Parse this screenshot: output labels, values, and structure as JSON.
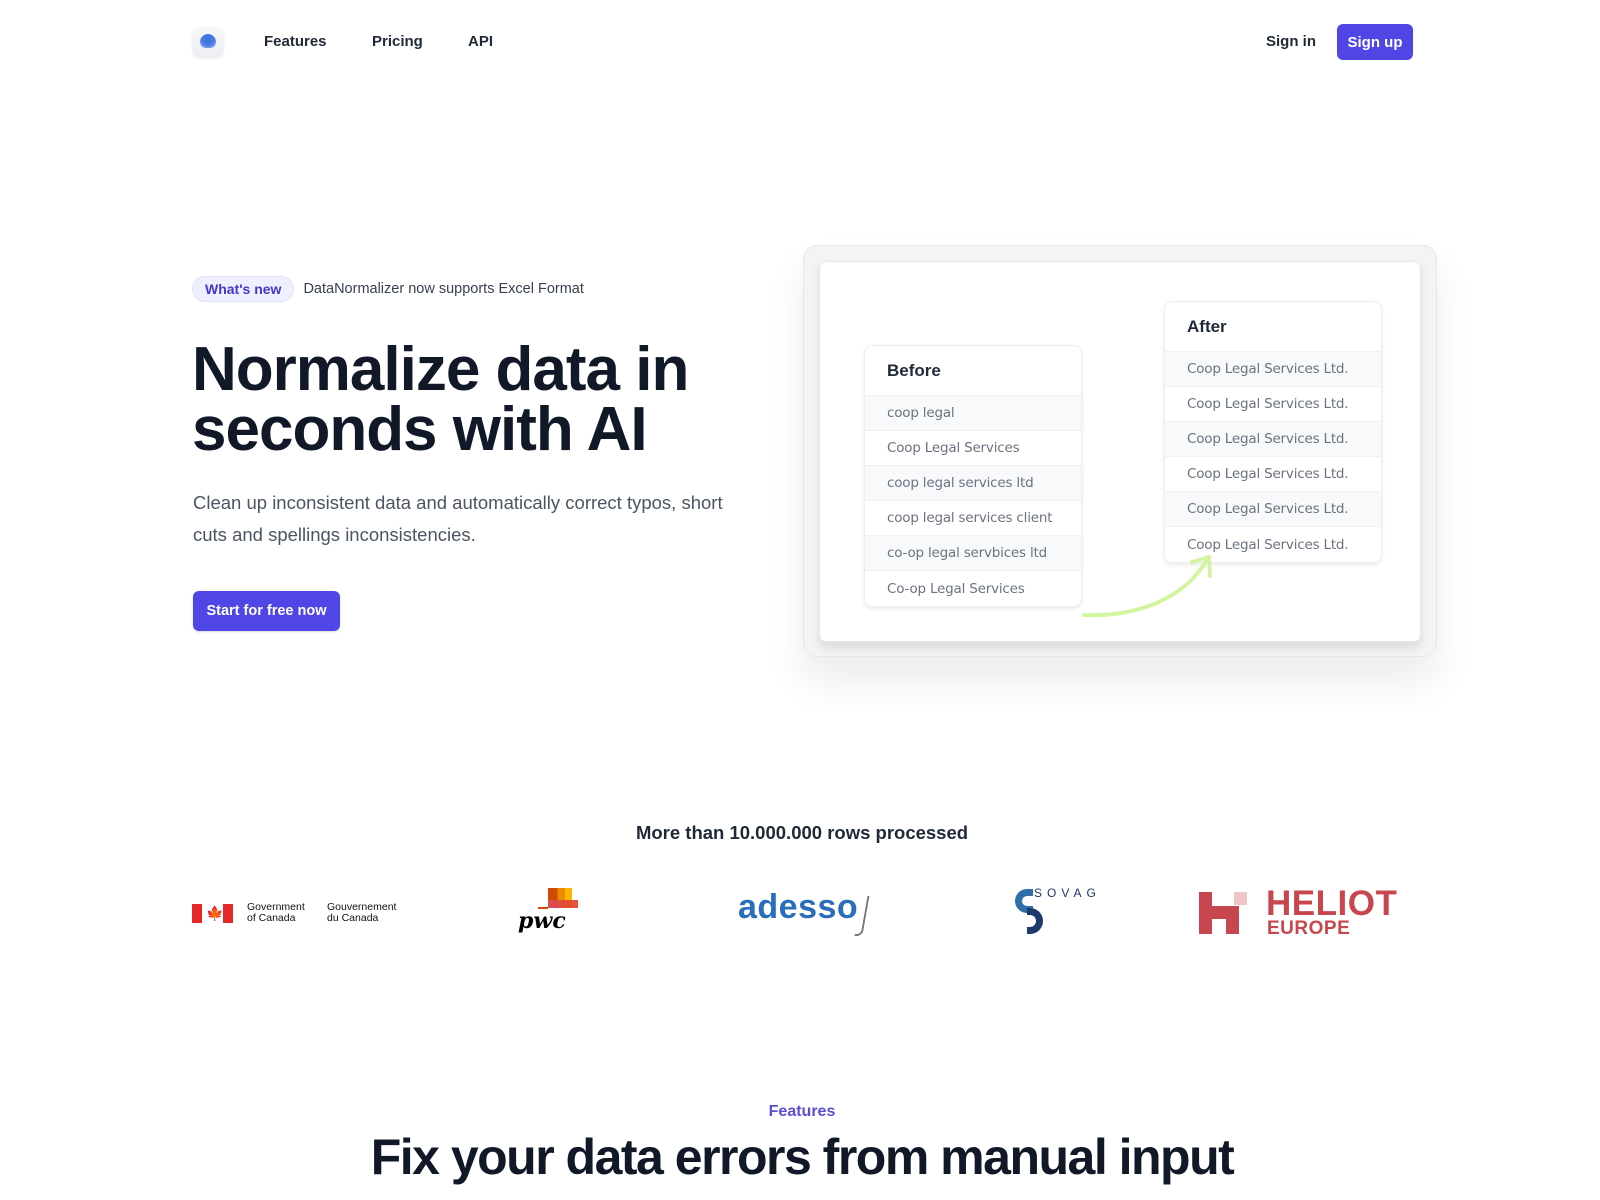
{
  "nav": {
    "logo_icon": "blue-dot-logo",
    "links": [
      "Features",
      "Pricing",
      "API"
    ],
    "sign_in": "Sign in",
    "sign_up": "Sign up"
  },
  "hero": {
    "badge": "What's new",
    "announcement": "DataNormalizer now supports Excel Format",
    "headline_line1": "Normalize data in",
    "headline_line2": "seconds with AI",
    "subtext": "Clean up inconsistent data and automatically correct typos, short cuts and spellings inconsistencies.",
    "cta": "Start for free now"
  },
  "illustration": {
    "before": {
      "title": "Before",
      "rows": [
        "coop legal",
        "Coop Legal Services",
        "coop legal services ltd",
        "coop legal services client",
        "co-op legal servbices ltd",
        "Co-op Legal Services"
      ]
    },
    "after": {
      "title": "After",
      "rows": [
        "Coop Legal Services Ltd.",
        "Coop Legal Services Ltd.",
        "Coop Legal Services Ltd.",
        "Coop Legal Services Ltd.",
        "Coop Legal Services Ltd.",
        "Coop Legal Services Ltd."
      ]
    },
    "arrow_color": "#d4f5a0"
  },
  "social_proof": {
    "stats": "More than 10.000.000 rows processed",
    "logos": {
      "canada_en_1": "Government",
      "canada_en_2": "of Canada",
      "canada_fr_1": "Gouvernement",
      "canada_fr_2": "du Canada",
      "pwc": "pwc",
      "adesso": "adesso",
      "sovag": "SOVAG",
      "heliot": "HELIOT",
      "heliot_sub": "EUROPE"
    }
  },
  "features": {
    "eyebrow": "Features",
    "title": "Fix your data errors from manual input"
  },
  "colors": {
    "brand": "#4f46e5",
    "text": "#111827"
  }
}
